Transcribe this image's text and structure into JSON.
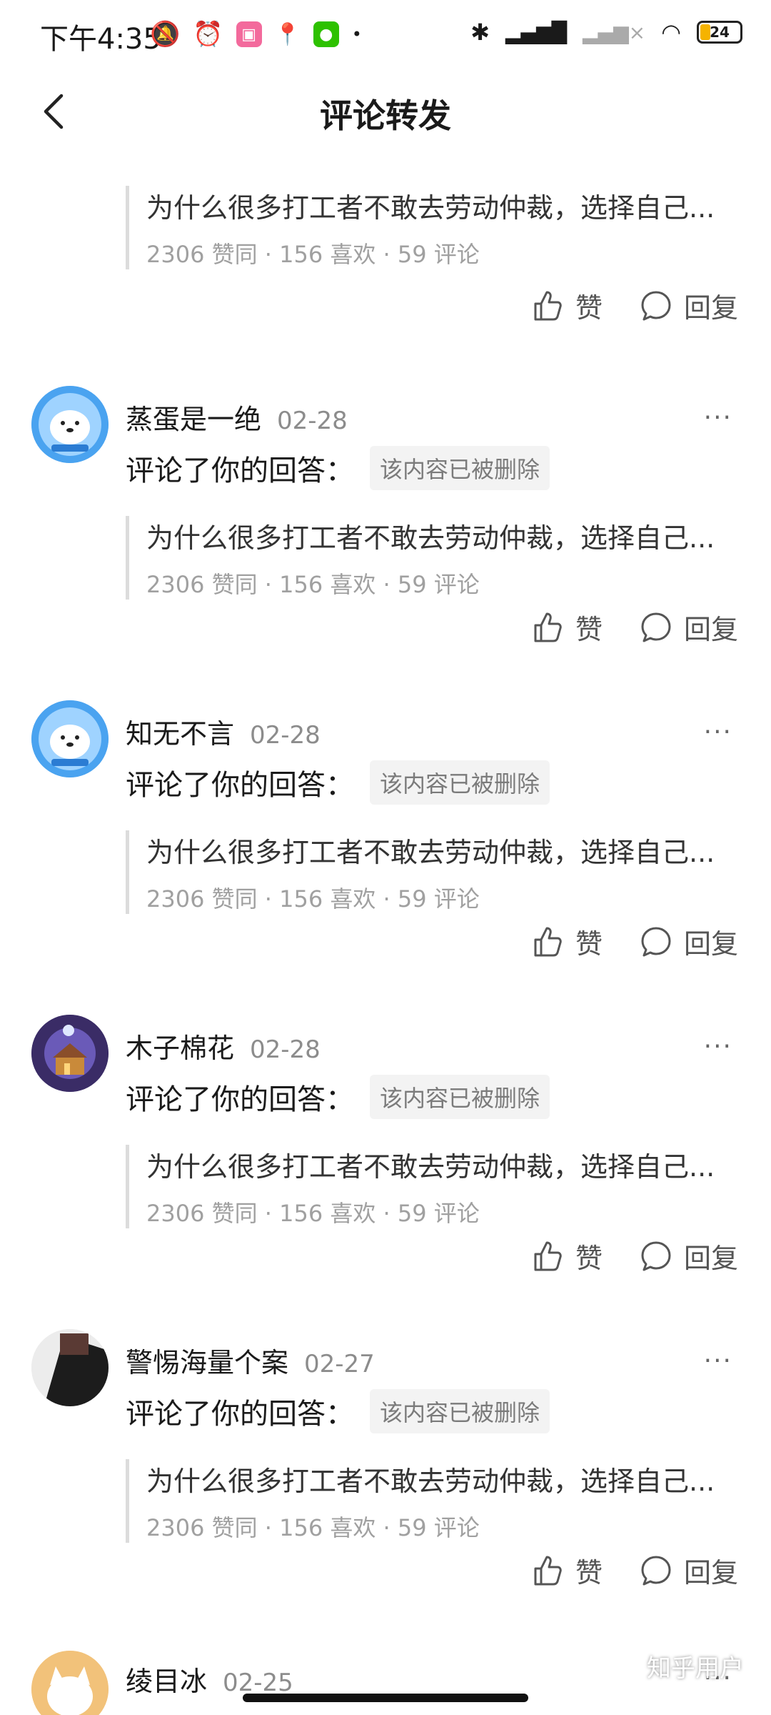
{
  "status": {
    "time": "下午4:35",
    "battery": "24"
  },
  "nav": {
    "title": "评论转发"
  },
  "quote": {
    "title": "为什么很多打工者不敢去劳动仲裁，选择自己...",
    "meta": "2306 赞同 · 156 喜欢 · 59 评论"
  },
  "buttons": {
    "like": "赞",
    "reply": "回复"
  },
  "action_text": "评论了你的回答：",
  "deleted_badge": "该内容已被删除",
  "more": "···",
  "items": [
    {
      "name": "蒸蛋是一绝",
      "date": "02-28"
    },
    {
      "name": "知无不言",
      "date": "02-28"
    },
    {
      "name": "木子棉花",
      "date": "02-28"
    },
    {
      "name": "警惕海量个案",
      "date": "02-27"
    },
    {
      "name": "绫目冰",
      "date": "02-25"
    }
  ],
  "watermark": "知乎用户",
  "colors": {
    "avatar_bear_bg": "#4aa3f0",
    "avatar_night_bg": "#3a2c66",
    "accent_battery": "#f5b300"
  }
}
